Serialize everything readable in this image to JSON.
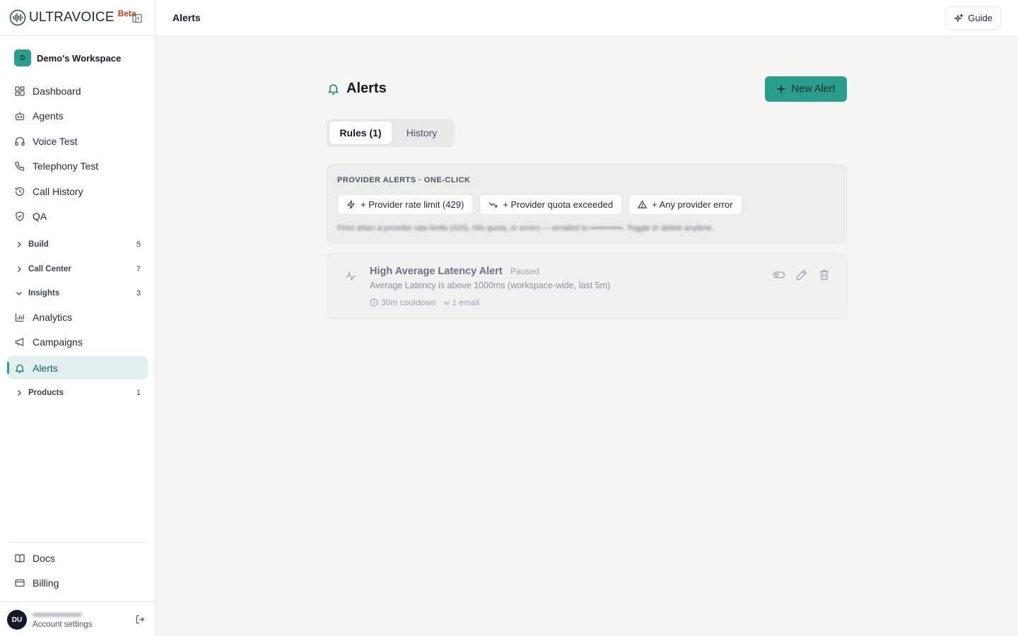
{
  "brand": {
    "name": "ULTRAVOICE",
    "badge": "Beta"
  },
  "workspace": {
    "initial": "D",
    "name": "Demo's Workspace"
  },
  "nav": {
    "dashboard": "Dashboard",
    "agents": "Agents",
    "voice_test": "Voice Test",
    "telephony_test": "Telephony Test",
    "call_history": "Call History",
    "qa": "QA",
    "analytics": "Analytics",
    "campaigns": "Campaigns",
    "alerts": "Alerts",
    "docs": "Docs",
    "billing": "Billing"
  },
  "groups": {
    "build": {
      "label": "Build",
      "count": "5",
      "expanded": false
    },
    "call_center": {
      "label": "Call Center",
      "count": "7",
      "expanded": false
    },
    "insights": {
      "label": "Insights",
      "count": "3",
      "expanded": true
    },
    "products": {
      "label": "Products",
      "count": "1",
      "expanded": false
    }
  },
  "user": {
    "initials": "DU",
    "settings_label": "Account settings"
  },
  "topbar": {
    "title": "Alerts",
    "guide_label": "Guide"
  },
  "page": {
    "title": "Alerts",
    "new_alert_label": "New Alert"
  },
  "tabs": {
    "rules": "Rules (1)",
    "history": "History",
    "active": "rules"
  },
  "provider_alerts": {
    "heading": "PROVIDER ALERTS · ONE-CLICK",
    "chips": {
      "rate_limit": "+ Provider rate limit (429)",
      "quota": "+ Provider quota exceeded",
      "any_error": "+ Any provider error"
    },
    "note": "Fires when a provider rate-limits (429), hits quota, or errors — emailed to ••••••••••••. Toggle or delete anytime."
  },
  "rules": [
    {
      "title": "High Average Latency Alert",
      "status": "Paused",
      "description": "Average Latency is above 1000ms (workspace-wide, last 5m)",
      "cooldown": "30m cooldown",
      "recipients": "1 email"
    }
  ],
  "colors": {
    "accent": "#2a9d8f",
    "active_nav_bg": "#e2f1ef",
    "beta": "#c2410c"
  },
  "icons": {
    "brand": "waveform-globe-icon",
    "guide": "sparkles-icon",
    "page_title": "bell-icon",
    "rule": "activity-icon",
    "cooldown": "clock-icon",
    "recipients": "mail-icon"
  }
}
